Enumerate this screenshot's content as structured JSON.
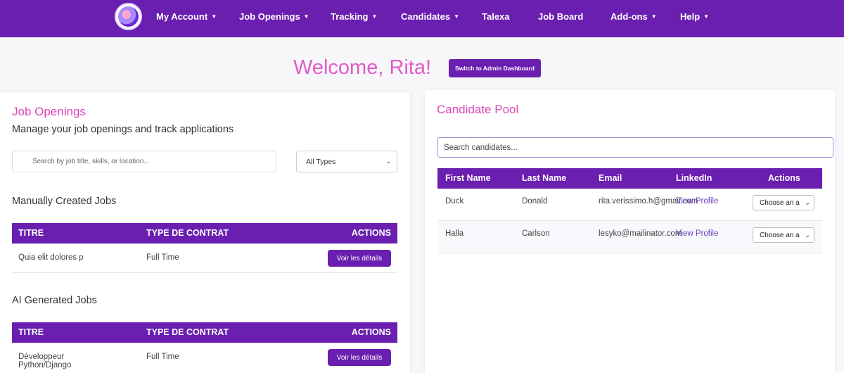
{
  "nav": {
    "items": [
      {
        "label": "My Account",
        "caret": "▼"
      },
      {
        "label": "Job Openings",
        "caret": "▼"
      },
      {
        "label": "Tracking",
        "caret": "▼"
      },
      {
        "label": "Candidates",
        "caret": "▼"
      },
      {
        "label": "Talexa",
        "caret": ""
      },
      {
        "label": "Job Board",
        "caret": ""
      },
      {
        "label": "Add-ons",
        "caret": "▼"
      },
      {
        "label": "Help",
        "caret": "▼"
      }
    ]
  },
  "welcome": {
    "text": "Welcome, Rita!",
    "admin_button": "Switch to Admin Dashboard"
  },
  "jobs": {
    "title": "Job Openings",
    "subtitle": "Manage your job openings and track applications",
    "search_placeholder": "Search by job title, skills, or location...",
    "type_filter": "All Types",
    "manual": {
      "title": "Manually Created Jobs",
      "headers": [
        "TITRE",
        "TYPE DE CONTRAT",
        "ACTIONS"
      ],
      "rows": [
        {
          "title": "Quia elit dolores p",
          "type": "Full Time",
          "action": "Voir les détails"
        }
      ]
    },
    "ai": {
      "title": "AI Generated Jobs",
      "headers": [
        "TITRE",
        "TYPE DE CONTRAT",
        "ACTIONS"
      ],
      "rows": [
        {
          "title": "Développeur Python/Django",
          "type": "Full Time",
          "action": "Voir les détails"
        }
      ]
    }
  },
  "candidates": {
    "title": "Candidate Pool",
    "search_placeholder": "Search candidates...",
    "headers": [
      "First Name",
      "Last Name",
      "Email",
      "LinkedIn",
      "Actions"
    ],
    "rows": [
      {
        "first": "Duck",
        "last": "Donald",
        "email": "rita.verissimo.h@gmail.com",
        "linkedin": "View Profile",
        "action": "Choose an a"
      },
      {
        "first": "Halla",
        "last": "Carlson",
        "email": "lesyko@mailinator.com",
        "linkedin": "View Profile",
        "action": "Choose an a"
      }
    ]
  },
  "colors": {
    "brand": "#6a1fb0",
    "accent": "#d946b8"
  }
}
